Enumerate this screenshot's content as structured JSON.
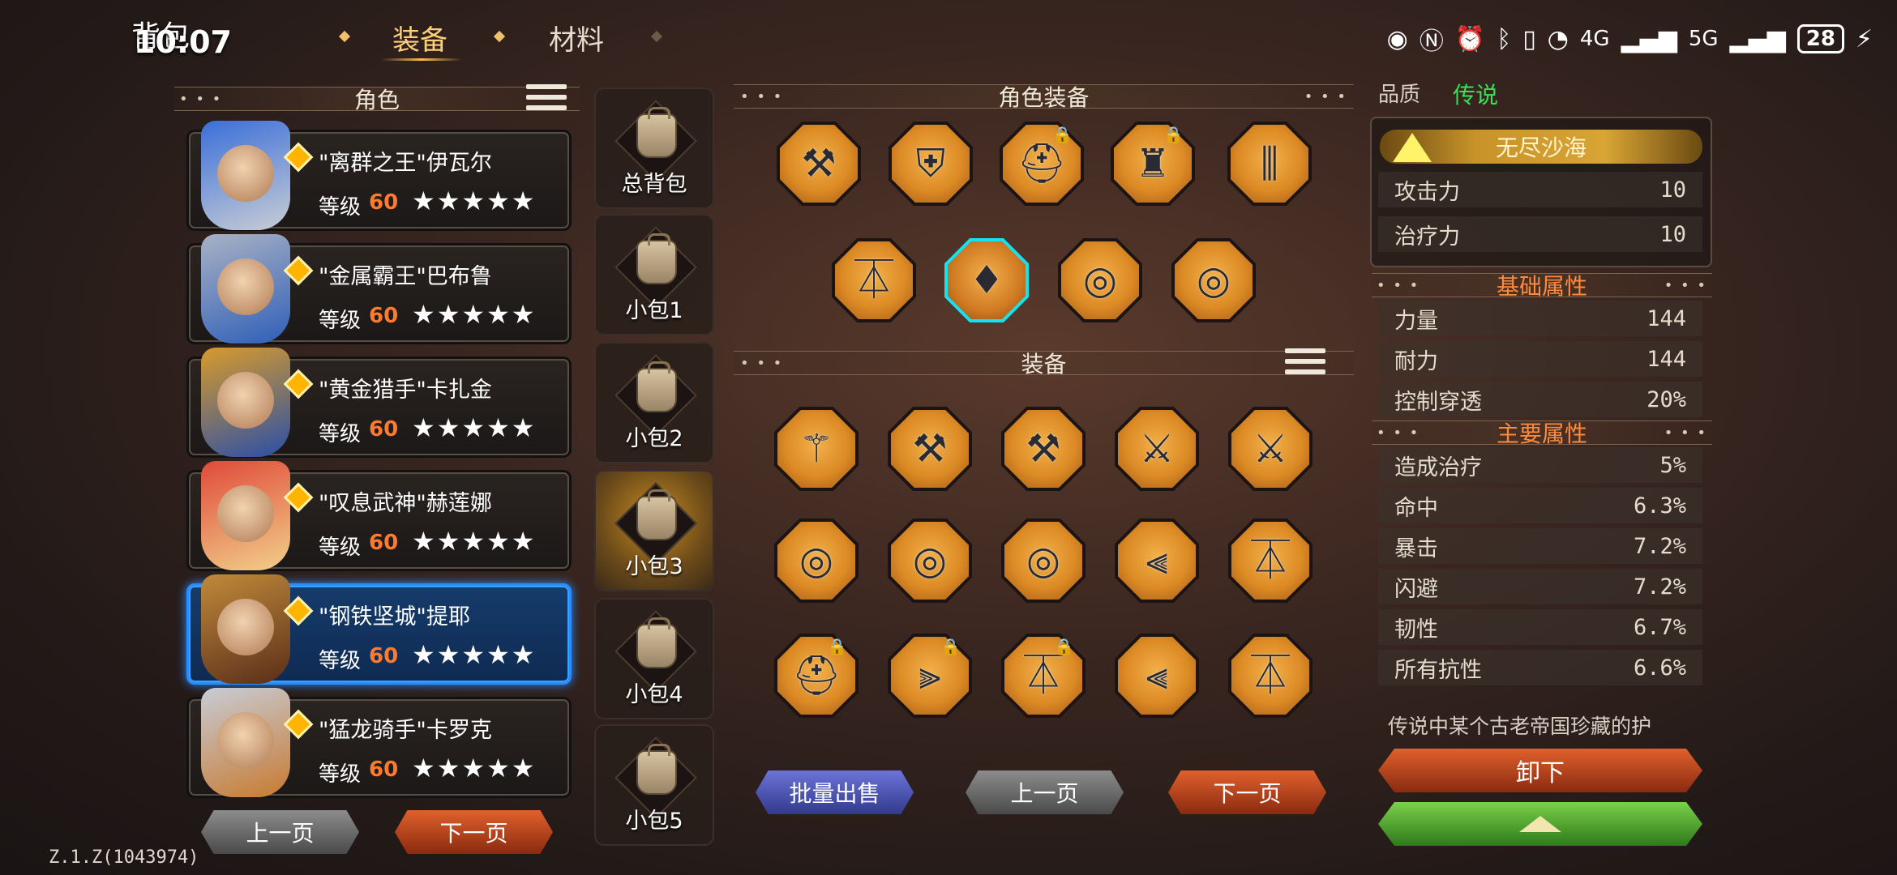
{
  "header": {
    "title": "背包",
    "clock": "10:07",
    "tabs": [
      {
        "label": "装备",
        "active": true
      },
      {
        "label": "材料",
        "active": false
      }
    ],
    "status": {
      "battery": "28",
      "net1": "4G",
      "net2": "5G"
    }
  },
  "characters_panel": {
    "title": "角色",
    "items": [
      {
        "name": "\"离群之王\"伊瓦尔",
        "level_label": "等级",
        "level": "60",
        "stars": "★★★★★",
        "selected": false,
        "colors": [
          "#3a6fd8",
          "#c9cdd6"
        ]
      },
      {
        "name": "\"金属霸王\"巴布鲁",
        "level_label": "等级",
        "level": "60",
        "stars": "★★★★★",
        "selected": false,
        "colors": [
          "#a9b2c4",
          "#2f5fb8"
        ]
      },
      {
        "name": "\"黄金猎手\"卡扎金",
        "level_label": "等级",
        "level": "60",
        "stars": "★★★★★",
        "selected": false,
        "colors": [
          "#d89b2a",
          "#2a4fa8"
        ]
      },
      {
        "name": "\"叹息武神\"赫莲娜",
        "level_label": "等级",
        "level": "60",
        "stars": "★★★★★",
        "selected": false,
        "colors": [
          "#e04a3a",
          "#f2d08a"
        ]
      },
      {
        "name": "\"钢铁坚城\"提耶",
        "level_label": "等级",
        "level": "60",
        "stars": "★★★★★",
        "selected": true,
        "colors": [
          "#c08a3a",
          "#5a2e1a"
        ]
      },
      {
        "name": "\"猛龙骑手\"卡罗克",
        "level_label": "等级",
        "level": "60",
        "stars": "★★★★★",
        "selected": false,
        "colors": [
          "#c8ccd6",
          "#c87a30"
        ]
      }
    ],
    "prev": "上一页",
    "next": "下一页"
  },
  "bags": [
    {
      "label": "总背包",
      "active": false
    },
    {
      "label": "小包1",
      "active": false
    },
    {
      "label": "小包2",
      "active": false
    },
    {
      "label": "小包3",
      "active": true
    },
    {
      "label": "小包4",
      "active": false
    },
    {
      "label": "小包5",
      "active": false
    }
  ],
  "char_equipment": {
    "title": "角色装备",
    "row1": [
      {
        "icon": "hammer-icon",
        "glyph": "⚒",
        "locked": false
      },
      {
        "icon": "shield-icon",
        "glyph": "⛨",
        "locked": false
      },
      {
        "icon": "helmet-icon",
        "glyph": "⛑",
        "locked": true
      },
      {
        "icon": "chest-armor-icon",
        "glyph": "♜",
        "locked": true
      },
      {
        "icon": "leg-armor-icon",
        "glyph": "⫼",
        "locked": false
      }
    ],
    "row2": [
      {
        "icon": "boots-icon",
        "glyph": "⏄",
        "locked": false,
        "selected": false
      },
      {
        "icon": "amulet-icon",
        "glyph": "♦",
        "locked": false,
        "selected": true
      },
      {
        "icon": "ring-icon",
        "glyph": "◎",
        "locked": false,
        "selected": false
      },
      {
        "icon": "ring-icon",
        "glyph": "◎",
        "locked": false,
        "selected": false
      }
    ]
  },
  "inventory": {
    "title": "装备",
    "rows": [
      [
        {
          "icon": "mace-icon",
          "glyph": "⚚",
          "locked": false
        },
        {
          "icon": "hammer-icon",
          "glyph": "⚒",
          "locked": false
        },
        {
          "icon": "hammer-icon",
          "glyph": "⚒",
          "locked": false
        },
        {
          "icon": "axe-icon",
          "glyph": "⚔",
          "locked": false
        },
        {
          "icon": "axe-icon",
          "glyph": "⚔",
          "locked": false
        }
      ],
      [
        {
          "icon": "ring-icon",
          "glyph": "◎",
          "locked": false
        },
        {
          "icon": "ring-icon",
          "glyph": "◎",
          "locked": false
        },
        {
          "icon": "ring-icon",
          "glyph": "◎",
          "locked": false
        },
        {
          "icon": "gauntlets-icon",
          "glyph": "⫷",
          "locked": false
        },
        {
          "icon": "boots-icon",
          "glyph": "⏄",
          "locked": false
        }
      ],
      [
        {
          "icon": "helmet-icon",
          "glyph": "⛑",
          "locked": true
        },
        {
          "icon": "bracers-icon",
          "glyph": "⫸",
          "locked": true
        },
        {
          "icon": "boots-icon",
          "glyph": "⏄",
          "locked": true
        },
        {
          "icon": "gauntlets-icon",
          "glyph": "⫷",
          "locked": false
        },
        {
          "icon": "boots-icon",
          "glyph": "⏄",
          "locked": false
        }
      ]
    ],
    "bulk_sell": "批量出售",
    "prev": "上一页",
    "next": "下一页"
  },
  "details": {
    "quality_label": "品质",
    "quality_value": "传说",
    "set_name": "无尽沙海",
    "set_stats": [
      {
        "name": "攻击力",
        "value": "10"
      },
      {
        "name": "治疗力",
        "value": "10"
      }
    ],
    "basic_title": "基础属性",
    "basic_stats": [
      {
        "name": "力量",
        "value": "144"
      },
      {
        "name": "耐力",
        "value": "144"
      },
      {
        "name": "控制穿透",
        "value": "20%"
      }
    ],
    "main_title": "主要属性",
    "main_stats": [
      {
        "name": "造成治疗",
        "value": "5%"
      },
      {
        "name": "命中",
        "value": "6.3%"
      },
      {
        "name": "暴击",
        "value": "7.2%"
      },
      {
        "name": "闪避",
        "value": "7.2%"
      },
      {
        "name": "韧性",
        "value": "6.7%"
      },
      {
        "name": "所有抗性",
        "value": "6.6%"
      }
    ],
    "description": "传说中某个古老帝国珍藏的护",
    "unequip": "卸下"
  },
  "version": "Z.1.Z(1043974)"
}
